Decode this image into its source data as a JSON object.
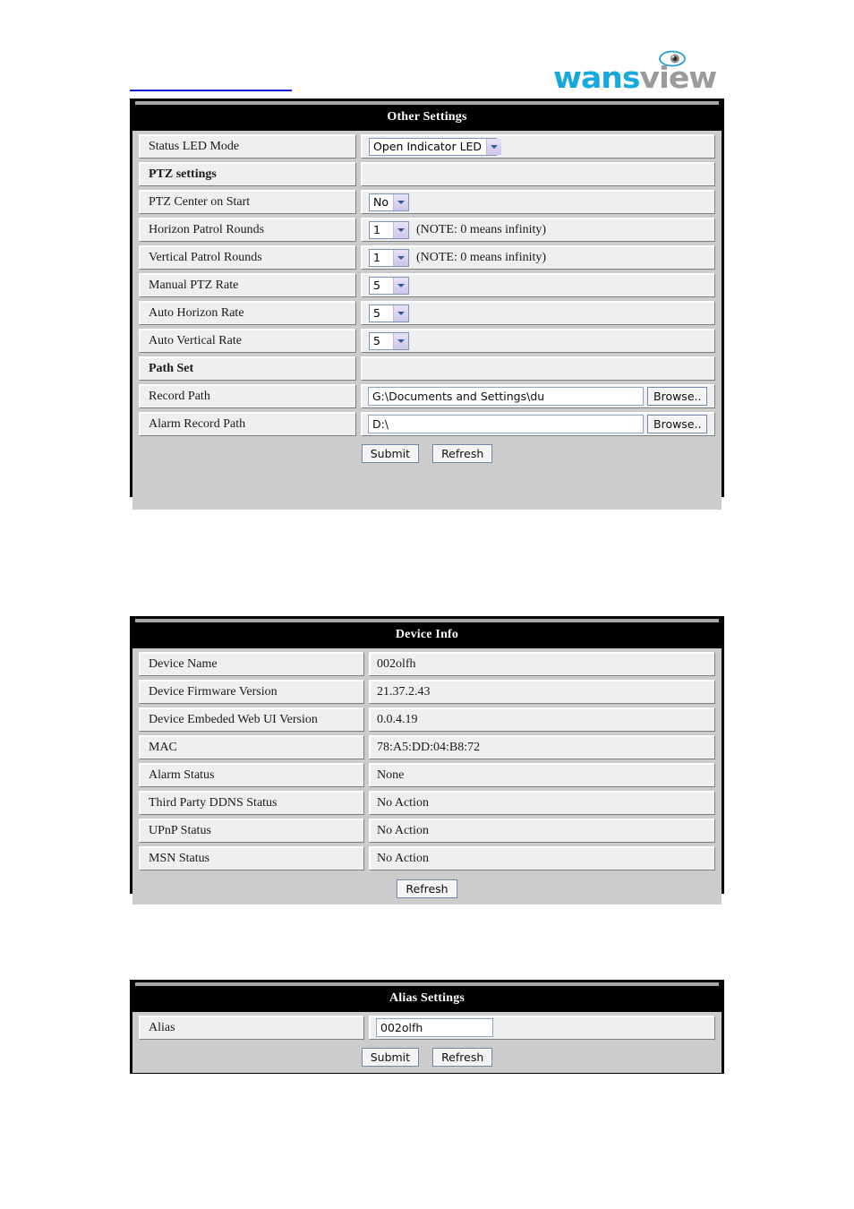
{
  "brand": {
    "name_part1": "wans",
    "name_part2": "view",
    "icon": "eye-icon",
    "color_primary": "#17a9dd",
    "color_secondary": "#9b9b9b"
  },
  "panels": {
    "other_settings": {
      "title": "Other Settings",
      "rows": [
        {
          "type": "select",
          "label": "Status LED Mode",
          "value": "Open Indicator LED",
          "width": "wide"
        },
        {
          "type": "section",
          "label": "PTZ settings",
          "value": ""
        },
        {
          "type": "select",
          "label": "PTZ Center on Start",
          "value": "No",
          "width": "small"
        },
        {
          "type": "select-note",
          "label": "Horizon Patrol Rounds",
          "value": "1",
          "note": "(NOTE: 0 means infinity)",
          "width": "small"
        },
        {
          "type": "select-note",
          "label": "Vertical Patrol Rounds",
          "value": "1",
          "note": "(NOTE: 0 means infinity)",
          "width": "small"
        },
        {
          "type": "select",
          "label": "Manual PTZ Rate",
          "value": "5",
          "width": "small"
        },
        {
          "type": "select",
          "label": "Auto Horizon Rate",
          "value": "5",
          "width": "small"
        },
        {
          "type": "select",
          "label": "Auto Vertical Rate",
          "value": "5",
          "width": "small"
        },
        {
          "type": "section",
          "label": "Path Set",
          "value": ""
        },
        {
          "type": "path",
          "label": "Record Path",
          "value": "G:\\Documents and Settings\\du",
          "browse_label": "Browse.."
        },
        {
          "type": "path",
          "label": "Alarm Record Path",
          "value": "D:\\",
          "browse_label": "Browse.."
        }
      ],
      "submit_label": "Submit",
      "refresh_label": "Refresh"
    },
    "device_info": {
      "title": "Device Info",
      "rows": [
        {
          "label": "Device Name",
          "value": "002olfh"
        },
        {
          "label": "Device Firmware Version",
          "value": "21.37.2.43"
        },
        {
          "label": "Device Embeded Web UI Version",
          "value": "0.0.4.19"
        },
        {
          "label": "MAC",
          "value": "78:A5:DD:04:B8:72"
        },
        {
          "label": "Alarm Status",
          "value": "None"
        },
        {
          "label": "Third Party DDNS Status",
          "value": "No Action"
        },
        {
          "label": "UPnP Status",
          "value": "No Action"
        },
        {
          "label": "MSN Status",
          "value": "No Action"
        }
      ],
      "refresh_label": "Refresh"
    },
    "alias_settings": {
      "title": "Alias Settings",
      "rows": [
        {
          "label": "Alias",
          "value": "002olfh"
        }
      ],
      "submit_label": "Submit",
      "refresh_label": "Refresh"
    }
  }
}
